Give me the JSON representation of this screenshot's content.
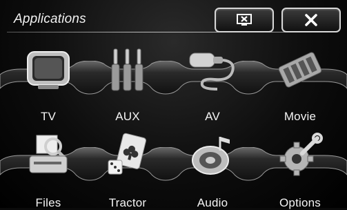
{
  "header": {
    "title": "Applications",
    "display_button_icon": "screen-off-icon",
    "close_button_icon": "close-icon"
  },
  "apps": [
    {
      "label": "TV",
      "icon": "tv-icon"
    },
    {
      "label": "AUX",
      "icon": "aux-jack-icon"
    },
    {
      "label": "AV",
      "icon": "av-cable-icon"
    },
    {
      "label": "Movie",
      "icon": "film-reel-icon"
    },
    {
      "label": "Files",
      "icon": "files-scanner-icon"
    },
    {
      "label": "Tractor",
      "icon": "cards-dice-icon"
    },
    {
      "label": "Audio",
      "icon": "audio-speaker-icon"
    },
    {
      "label": "Options",
      "icon": "wrench-gear-icon"
    }
  ]
}
